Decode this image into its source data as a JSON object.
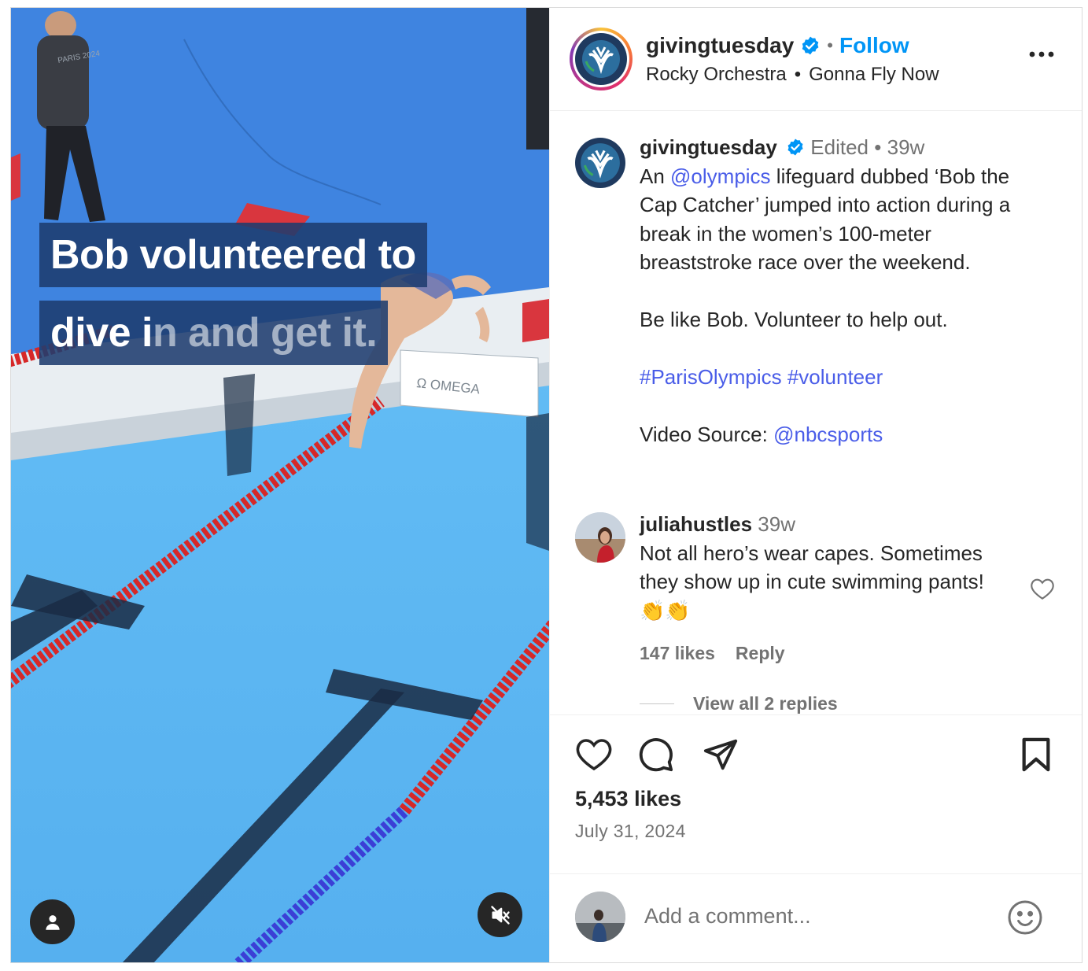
{
  "media": {
    "caption_line1": "Bob volunteered to",
    "caption_line2_a": "dive i",
    "caption_line2_b": "n and get it.",
    "sign_text": "Ω OMEGA",
    "official_shirt": "PARIS 2024"
  },
  "header": {
    "username": "givingtuesday",
    "follow_label": "Follow",
    "separator": "•",
    "audio_artist": "Rocky Orchestra",
    "audio_sep": "•",
    "audio_track": "Gonna Fly Now"
  },
  "post": {
    "username": "givingtuesday",
    "edited": "Edited",
    "sep": "•",
    "age": "39w",
    "text_prefix": "An ",
    "mention": "@olympics",
    "text_body": " lifeguard dubbed ‘Bob the Cap Catcher’ jumped into action during a break in the women’s 100-meter breaststroke race over the weekend.",
    "line2": "Be like Bob. Volunteer to help out.",
    "hashtag1": "#ParisOlympics",
    "hashtag2": "#volunteer",
    "source_label": "Video Source: ",
    "source_mention": "@nbcsports"
  },
  "comment": {
    "username": "juliahustles",
    "age": "39w",
    "text": "Not all hero’s wear capes. Sometimes they show up in cute swimming pants! 👏👏",
    "likes": "147 likes",
    "reply": "Reply",
    "view_replies": "View all 2 replies"
  },
  "stats": {
    "likes": "5,453 likes",
    "date": "July 31, 2024"
  },
  "composer": {
    "placeholder": "Add a comment..."
  },
  "colors": {
    "link": "#4a5de8",
    "follow": "#0095f6",
    "verified": "#0095f6",
    "pool_deep": "#3f84e0",
    "pool_light": "#5cb6f2"
  }
}
